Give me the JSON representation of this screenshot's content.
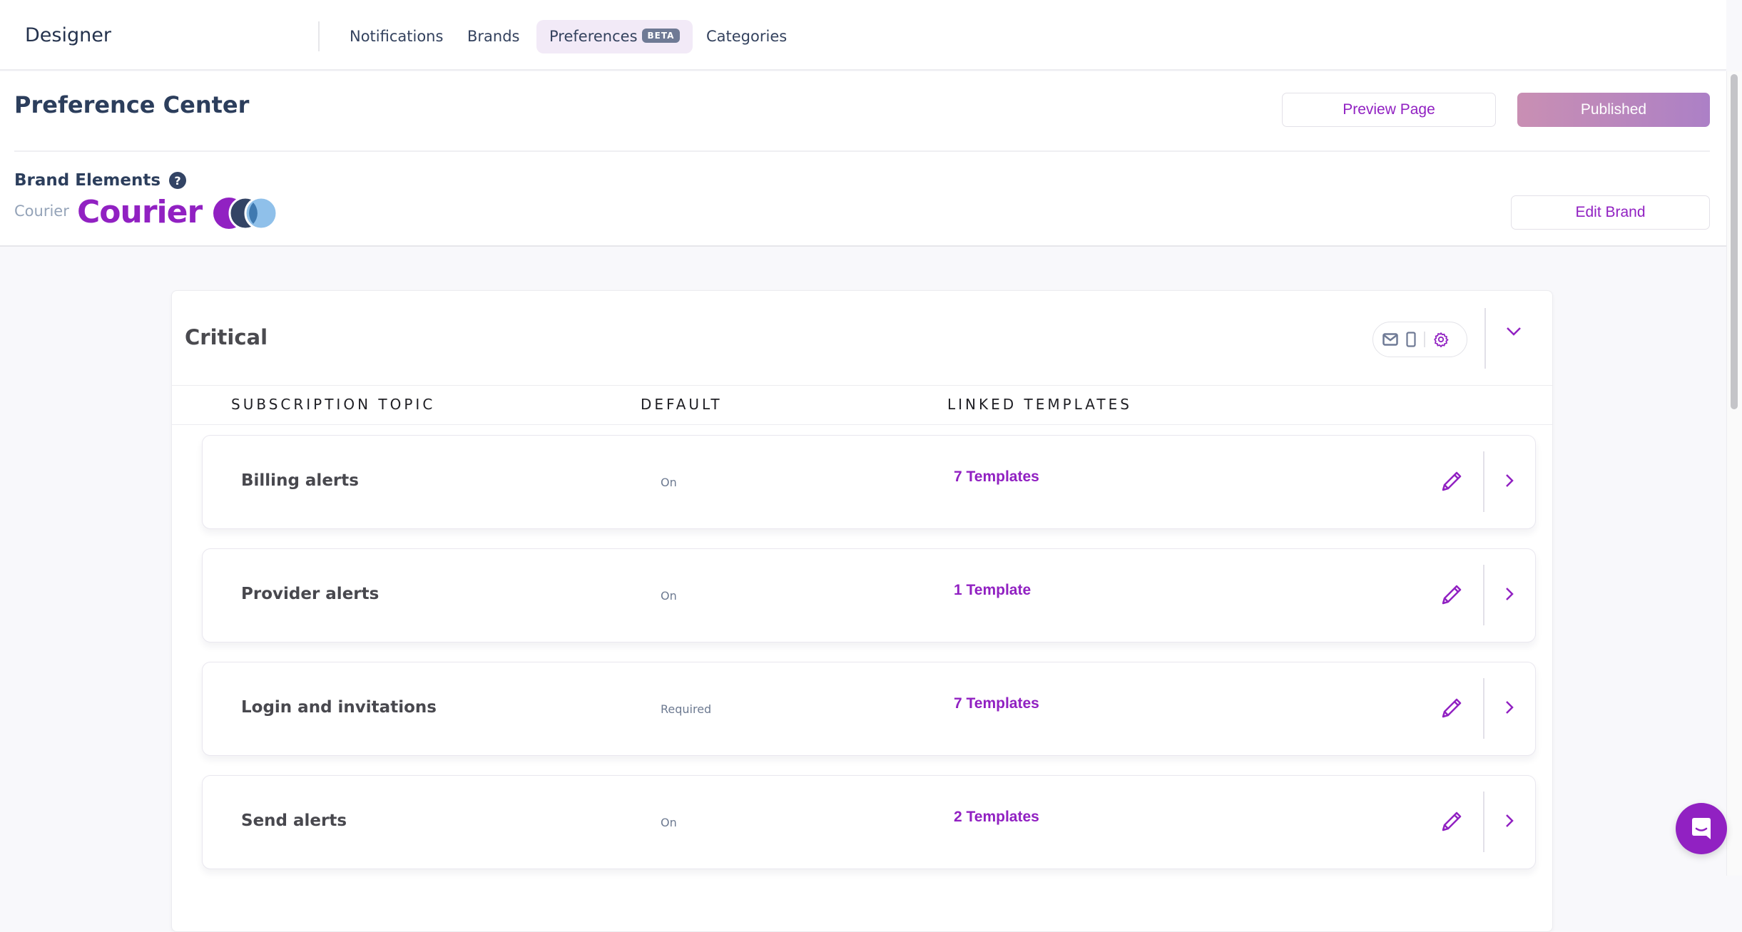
{
  "app": {
    "title": "Designer"
  },
  "nav": {
    "items": [
      {
        "label": "Notifications",
        "active": false
      },
      {
        "label": "Brands",
        "active": false
      },
      {
        "label": "Preferences",
        "active": true,
        "badge": "BETA"
      },
      {
        "label": "Categories",
        "active": false
      }
    ]
  },
  "header": {
    "title": "Preference Center",
    "preview_label": "Preview Page",
    "publish_label": "Published",
    "brand_elements_label": "Brand Elements",
    "help_glyph": "?",
    "brand_name": "Courier",
    "brand_logo_text": "Courier",
    "brand_colors": [
      "#9121c2",
      "#334465",
      "#8fc0ea"
    ],
    "edit_brand_label": "Edit Brand"
  },
  "section": {
    "title": "Critical",
    "channel_icons": [
      "mail-icon",
      "mobile-icon",
      "gear-icon"
    ],
    "columns": [
      "SUBSCRIPTION TOPIC",
      "DEFAULT",
      "LINKED TEMPLATES"
    ],
    "rows": [
      {
        "topic": "Billing alerts",
        "default": "On",
        "templates": "7 Templates"
      },
      {
        "topic": "Provider alerts",
        "default": "On",
        "templates": "1 Template"
      },
      {
        "topic": "Login and invitations",
        "default": "Required",
        "templates": "7 Templates"
      },
      {
        "topic": "Send alerts",
        "default": "On",
        "templates": "2 Templates"
      }
    ]
  },
  "colors": {
    "accent": "#9121c2",
    "text_dark": "#2c3e5c",
    "muted": "#6d7a91"
  }
}
